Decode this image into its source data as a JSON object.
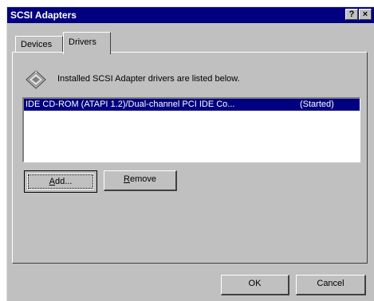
{
  "window": {
    "title": "SCSI Adapters",
    "help_label": "?",
    "close_label": "×"
  },
  "tabs": [
    {
      "label": "Devices",
      "selected": false
    },
    {
      "label": "Drivers",
      "selected": true
    }
  ],
  "drivers_panel": {
    "description": "Installed SCSI Adapter drivers are listed below.",
    "icon": "scsi-adapter-icon",
    "rows": [
      {
        "name": "IDE CD-ROM (ATAPI 1.2)/Dual-channel PCI IDE Co...",
        "status": "(Started)",
        "selected": true
      }
    ],
    "add_accel": "A",
    "add_rest": "dd...",
    "remove_accel": "R",
    "remove_rest": "emove"
  },
  "footer": {
    "ok_label": "OK",
    "cancel_label": "Cancel"
  },
  "colors": {
    "titlebar": "#000080",
    "face": "#c0c0c0",
    "selection": "#000080"
  }
}
